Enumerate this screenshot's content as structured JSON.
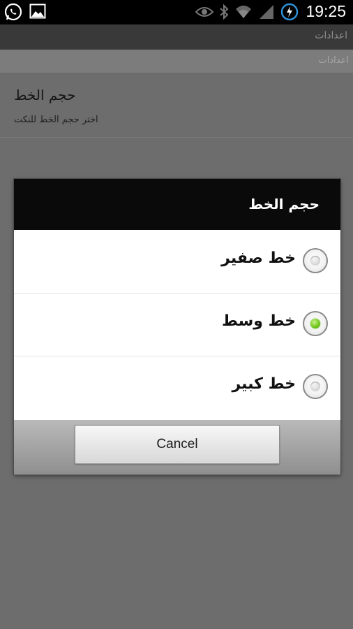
{
  "status_bar": {
    "time": "19:25",
    "left_icons": [
      "whatsapp-icon",
      "gallery-icon"
    ],
    "right_icons": [
      "eye-icon",
      "bluetooth-icon",
      "wifi-icon",
      "signal-icon",
      "battery-charging-icon"
    ]
  },
  "app_bar": {
    "title": "اعدادات"
  },
  "settings": {
    "section_title": "اعدادات",
    "item": {
      "title": "حجم الخط",
      "summary": "اختر حجم الخط للنكت"
    }
  },
  "dialog": {
    "title": "حجم الخط",
    "options": [
      {
        "label": "خط صفير",
        "checked": false
      },
      {
        "label": "خط وسط",
        "checked": true
      },
      {
        "label": "خط كبير",
        "checked": false
      }
    ],
    "cancel_label": "Cancel"
  },
  "colors": {
    "radio_selected": "#6cc417",
    "dialog_header": "#0a0a0a"
  }
}
